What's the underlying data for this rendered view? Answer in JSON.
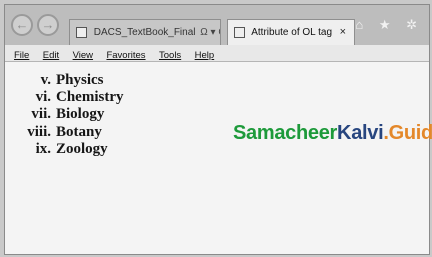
{
  "browser": {
    "tabs": [
      {
        "label": "DACS_TextBook_Final",
        "controls": "Ω ▾ C",
        "active": false
      },
      {
        "label": "Attribute of OL tag",
        "close": "×",
        "active": true
      }
    ],
    "right_icons": "⌂ ★ ✲",
    "menu": [
      "File",
      "Edit",
      "View",
      "Favorites",
      "Tools",
      "Help"
    ]
  },
  "page": {
    "list_items": [
      {
        "number": "v.",
        "text": "Physics"
      },
      {
        "number": "vi.",
        "text": "Chemistry"
      },
      {
        "number": "vii.",
        "text": "Biology"
      },
      {
        "number": "viii.",
        "text": "Botany"
      },
      {
        "number": "ix.",
        "text": "Zoology"
      }
    ],
    "watermark": {
      "part1": "Samacheer",
      "part2": "Kalvi",
      "part3": ".Guide"
    }
  },
  "colors": {
    "watermark_green": "#1d9a3a",
    "watermark_blue": "#27457f",
    "watermark_orange": "#e4882a"
  }
}
